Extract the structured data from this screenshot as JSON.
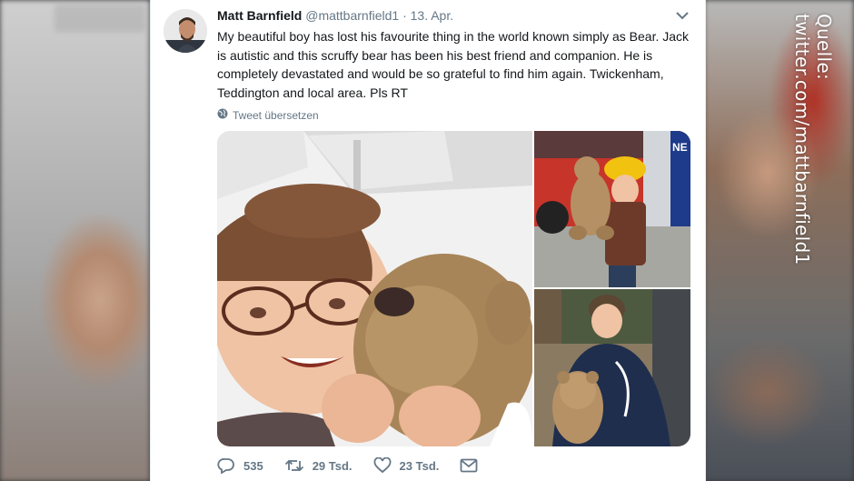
{
  "watermark": "Quelle: twitter.com/mattbarnfield1",
  "tweet": {
    "name": "Matt Barnfield",
    "handle": "@mattbarnfield1",
    "separator": "·",
    "date": "13. Apr.",
    "text": "My beautiful boy has lost his favourite thing in the world known simply as Bear. Jack is autistic and this scruffy bear has been his best friend and companion. He is completely devastated and would be so grateful to find him again. Twickenham, Teddington and local area. Pls RT",
    "translate_label": "Tweet übersetzen",
    "replies": "535",
    "retweets": "29 Tsd.",
    "likes": "23 Tsd.",
    "icons": [
      "globe-icon",
      "chevron-down-icon",
      "reply-icon",
      "retweet-icon",
      "heart-icon",
      "mail-icon"
    ]
  }
}
